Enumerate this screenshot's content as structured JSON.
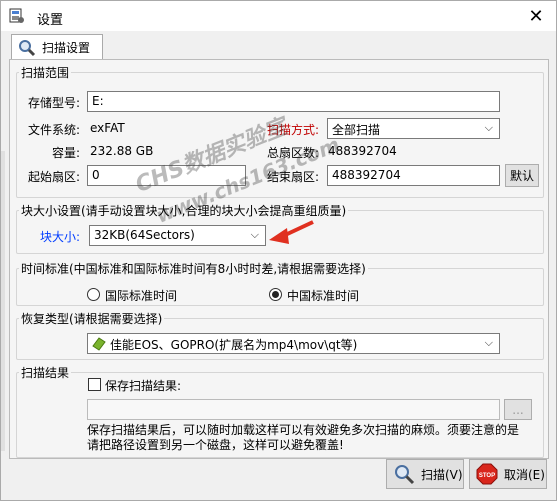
{
  "window": {
    "title": "设置",
    "close_glyph": "✕"
  },
  "tab": {
    "label": "扫描设置",
    "icon": "magnifier-icon"
  },
  "scan_range": {
    "legend": "扫描范围",
    "storage_model_label": "存储型号:",
    "storage_model_value": "E:",
    "filesystem_label": "文件系统:",
    "filesystem_value": "exFAT",
    "scan_mode_label": "扫描方式:",
    "scan_mode_value": "全部扫描",
    "capacity_label": "容量:",
    "capacity_value": "232.88 GB",
    "total_sectors_label": "总扇区数:",
    "total_sectors_value": "488392704",
    "start_sector_label": "起始扇区:",
    "start_sector_value": "0",
    "end_sector_label": "结束扇区:",
    "end_sector_value": "488392704",
    "default_button": "默认"
  },
  "block_size": {
    "legend": "块大小设置(请手动设置块大小,合理的块大小会提高重组质量)",
    "label": "块大小:",
    "value": "32KB(64Sectors)"
  },
  "time_standard": {
    "legend": "时间标准(中国标准和国际标准时间有8小时时差,请根据需要选择)",
    "option_international": "国际标准时间",
    "option_china": "中国标准时间",
    "selected": "china"
  },
  "recovery_type": {
    "legend": "恢复类型(请根据需要选择)",
    "value": "佳能EOS、GOPRO(扩展名为mp4\\mov\\qt等)"
  },
  "scan_result": {
    "legend": "扫描结果",
    "save_label": "保存扫描结果:",
    "path_value": "",
    "browse_button": "...",
    "note": "保存扫描结果后，可以随时加载这样可以有效避免多次扫描的麻烦。须要注意的是请把路径设置到另一个磁盘，这样可以避免覆盖!"
  },
  "buttons": {
    "scan": "扫描(V)",
    "cancel": "取消(E)"
  },
  "watermark": {
    "line1": "CHS数据实验室",
    "line2": "www.chs163.com"
  },
  "colors": {
    "red_label": "#c00000",
    "blue_label": "#003cff",
    "arrow": "#e03020"
  }
}
